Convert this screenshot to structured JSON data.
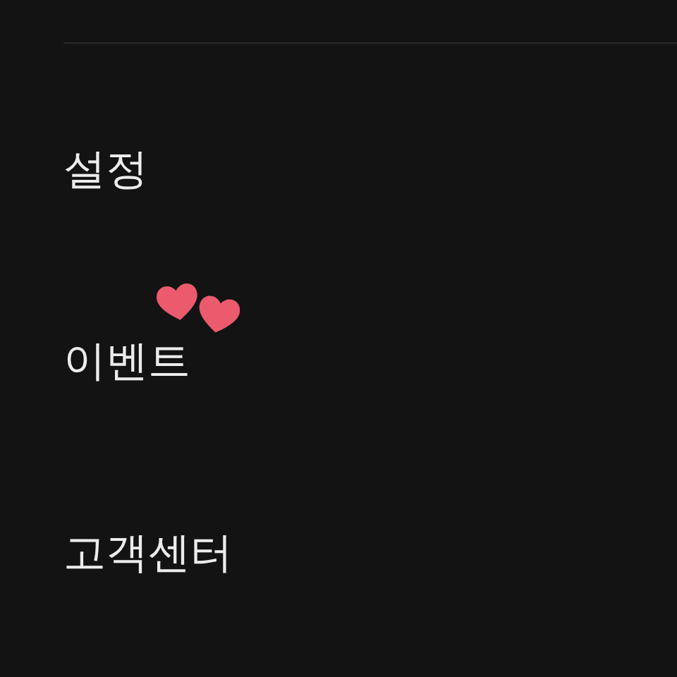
{
  "menu": [
    {
      "label": "설정"
    },
    {
      "label": "이벤트",
      "badge": true
    },
    {
      "label": "고객센터"
    }
  ]
}
